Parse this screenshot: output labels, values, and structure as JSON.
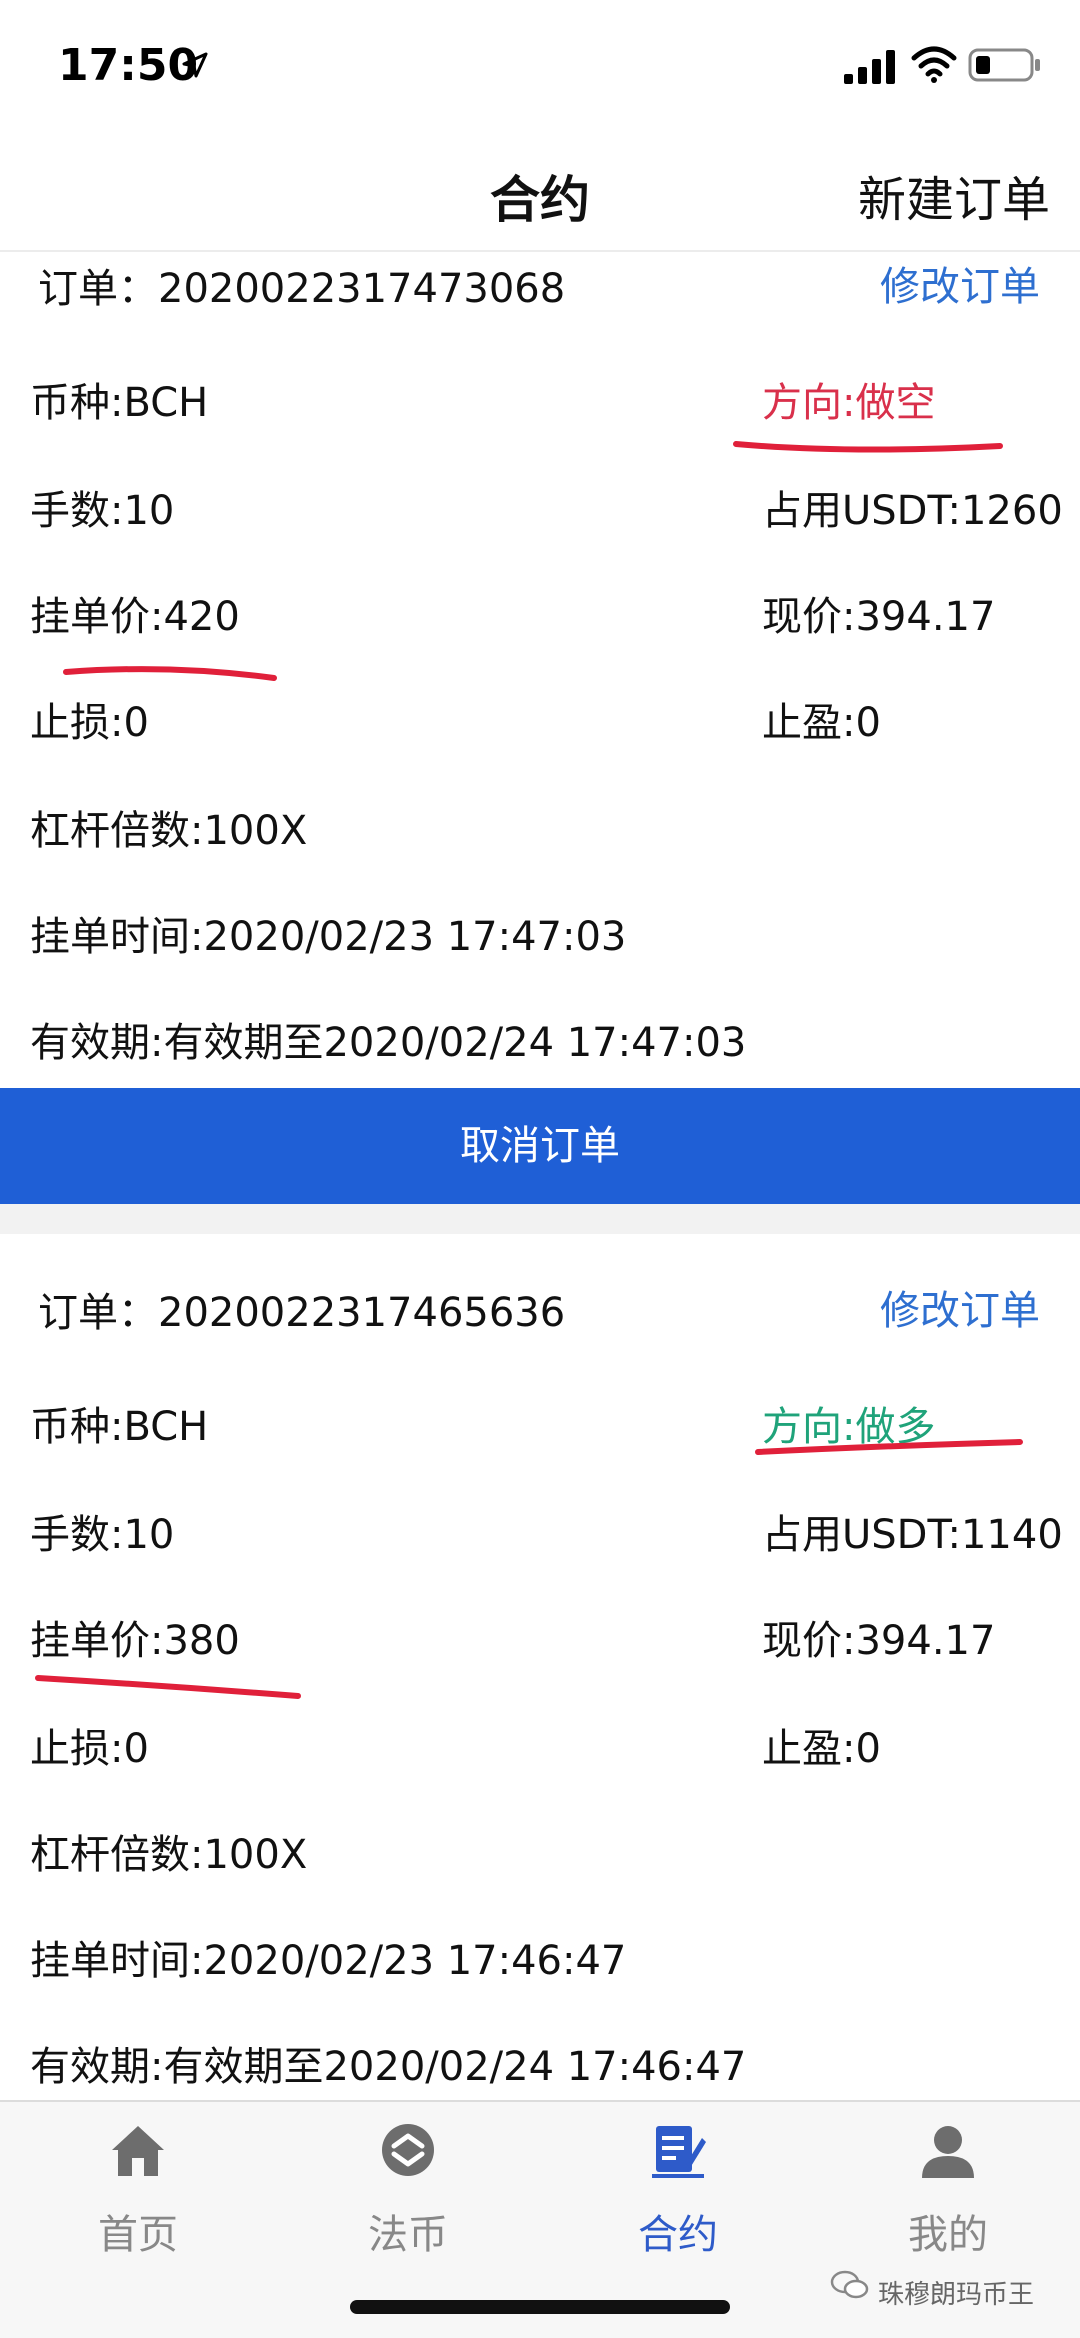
{
  "status_bar": {
    "time": "17:50"
  },
  "nav": {
    "title": "合约",
    "action": "新建订单"
  },
  "orders": [
    {
      "id_label": "订单：2020022317473068",
      "modify": "修改订单",
      "coin": "币种:BCH",
      "direction": "方向:做空",
      "lots": "手数:10",
      "margin": "占用USDT:1260",
      "limit_price": "挂单价:420",
      "current_price": "现价:394.17",
      "stop_loss": "止损:0",
      "take_profit": "止盈:0",
      "leverage": "杠杆倍数:100X",
      "order_time": "挂单时间:2020/02/23 17:47:03",
      "validity": "有效期:有效期至2020/02/24 17:47:03",
      "cancel": "取消订单"
    },
    {
      "id_label": "订单：2020022317465636",
      "modify": "修改订单",
      "coin": "币种:BCH",
      "direction": "方向:做多",
      "lots": "手数:10",
      "margin": "占用USDT:1140",
      "limit_price": "挂单价:380",
      "current_price": "现价:394.17",
      "stop_loss": "止损:0",
      "take_profit": "止盈:0",
      "leverage": "杠杆倍数:100X",
      "order_time": "挂单时间:2020/02/23 17:46:47",
      "validity": "有效期:有效期至2020/02/24 17:46:47"
    }
  ],
  "colors": {
    "accent": "#1f5fd6",
    "link": "#2e6fd0",
    "short": "#d9304b",
    "long": "#1fa37a",
    "annotation": "#e0203a"
  },
  "tabs": [
    {
      "label": "首页",
      "icon": "home-icon"
    },
    {
      "label": "法币",
      "icon": "fiat-icon"
    },
    {
      "label": "合约",
      "icon": "contract-icon",
      "active": true
    },
    {
      "label": "我的",
      "icon": "profile-icon"
    }
  ],
  "watermark": "珠穆朗玛币王"
}
